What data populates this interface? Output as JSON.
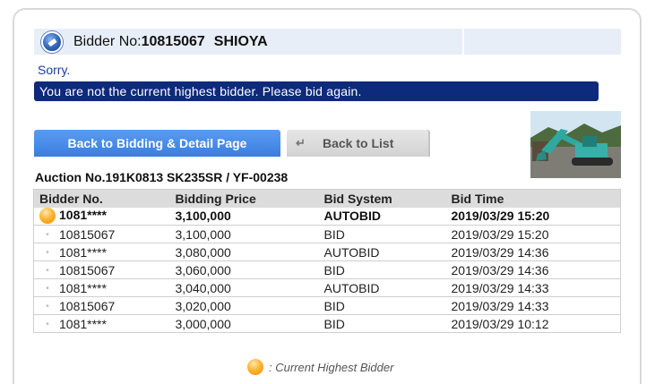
{
  "header": {
    "bidder_label": "Bidder No:",
    "bidder_no": "10815067",
    "bidder_name": "SHIOYA"
  },
  "message": {
    "sorry": "Sorry.",
    "notice": "You are not the current highest bidder. Please bid again."
  },
  "buttons": {
    "back_to_bidding": "Back to Bidding & Detail Page",
    "back_to_list": "Back to List"
  },
  "auction": {
    "title": "Auction No.191K0813  SK235SR / YF-00238"
  },
  "table": {
    "headers": [
      "Bidder No.",
      "Bidding Price",
      "Bid System",
      "Bid Time"
    ],
    "rows": [
      {
        "bidder": "1081****",
        "price": "3,100,000",
        "system": "AUTOBID",
        "time": "2019/03/29 15:20",
        "highest": true
      },
      {
        "bidder": "10815067",
        "price": "3,100,000",
        "system": "BID",
        "time": "2019/03/29 15:20",
        "highest": false
      },
      {
        "bidder": "1081****",
        "price": "3,080,000",
        "system": "AUTOBID",
        "time": "2019/03/29 14:36",
        "highest": false
      },
      {
        "bidder": "10815067",
        "price": "3,060,000",
        "system": "BID",
        "time": "2019/03/29 14:36",
        "highest": false
      },
      {
        "bidder": "1081****",
        "price": "3,040,000",
        "system": "AUTOBID",
        "time": "2019/03/29 14:33",
        "highest": false
      },
      {
        "bidder": "10815067",
        "price": "3,020,000",
        "system": "BID",
        "time": "2019/03/29 14:33",
        "highest": false
      },
      {
        "bidder": "1081****",
        "price": "3,000,000",
        "system": "BID",
        "time": "2019/03/29 10:12",
        "highest": false
      }
    ]
  },
  "legend": {
    "label": ": Current Highest Bidder"
  },
  "colors": {
    "notice_bg": "#0e2a7a",
    "button_blue": "#3a7de0",
    "highest_dot": "#ffb532"
  }
}
